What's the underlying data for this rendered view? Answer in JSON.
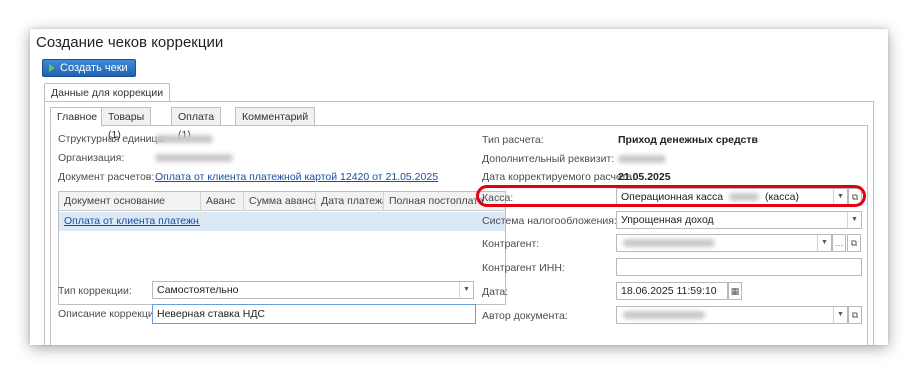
{
  "window": {
    "title": "Создание чеков коррекции"
  },
  "toolbar": {
    "create_label": "Создать чеки"
  },
  "outer_tab": {
    "label": "Данные для коррекции"
  },
  "tabs": [
    {
      "label": "Главное"
    },
    {
      "label": "Товары (1)"
    },
    {
      "label": "Оплата (1)"
    },
    {
      "label": "Комментарий"
    }
  ],
  "left": {
    "structural_unit_label": "Структурная единица:",
    "organization_label": "Организация:",
    "settlement_doc_label": "Документ расчетов:",
    "settlement_doc_link": "Оплата от клиента платежной картой 12420 от 21.05.2025",
    "table": {
      "columns": [
        "Документ основание",
        "Аванс",
        "Сумма аванса",
        "Дата платежа",
        "Полная постоплата"
      ],
      "rows": [
        {
          "doc": "Оплата от клиента платежн..."
        }
      ]
    },
    "correction_type_label": "Тип коррекции:",
    "correction_type_value": "Самостоятельно",
    "correction_desc_label": "Описание коррекции:",
    "correction_desc_value": "Неверная ставка НДС"
  },
  "right": {
    "payment_type_label": "Тип расчета:",
    "payment_type_value": "Приход денежных средств",
    "extra_attr_label": "Дополнительный реквизит:",
    "corrected_date_label": "Дата корректируемого расчета:",
    "corrected_date_value": "21.05.2025",
    "cash_label": "Касса:",
    "cash_value_prefix": "Операционная касса",
    "cash_value_suffix": "(касса)",
    "tax_label": "Система налогообложения:",
    "tax_value": "Упрощенная доход",
    "counterparty_label": "Контрагент:",
    "counterparty_inn_label": "Контрагент ИНН:",
    "date_label": "Дата:",
    "date_value": "18.06.2025 11:59:10",
    "author_label": "Автор документа:"
  },
  "colors": {
    "accent_blue": "#1f63b0",
    "highlight_red": "#e3000f",
    "row_selected": "#dbe9f6"
  },
  "icons": [
    "play-icon",
    "chevron-down-icon",
    "open-form-icon",
    "calendar-icon",
    "ellipsis-icon"
  ]
}
